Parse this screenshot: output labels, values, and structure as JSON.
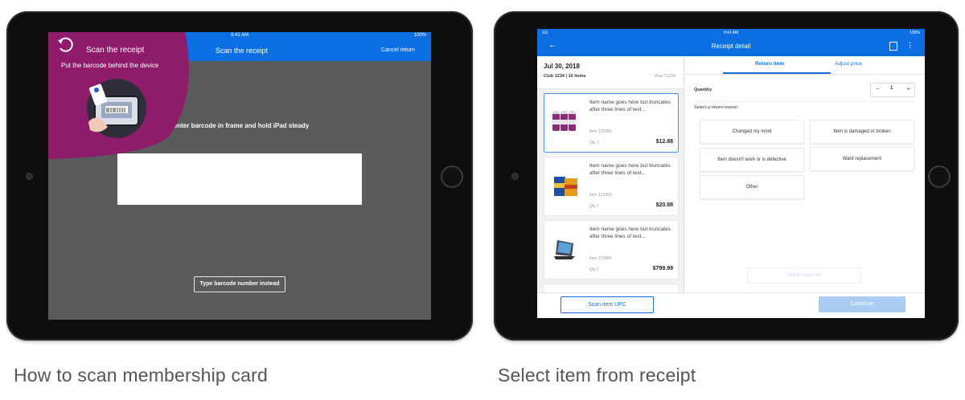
{
  "captions": {
    "left": "How to scan membership card",
    "right": "Select item from receipt"
  },
  "left_screen": {
    "status_time": "9:41 AM",
    "status_battery": "100%",
    "nav_title": "Scan the receipt",
    "nav_cancel": "Cancel return",
    "overlay_title": "Scan the receipt",
    "overlay_subtitle": "Put the barcode behind the device",
    "instruction": "Center barcode in frame and hold iPad steady",
    "type_barcode_button": "Type barcode number instead",
    "colors": {
      "accent_blue": "#0b6fe3",
      "overlay_purple": "#8e1c6a",
      "background_gray": "#5b5b5b"
    }
  },
  "right_screen": {
    "status_left": "GS",
    "status_time": "9:41 AM",
    "status_battery": "100%",
    "nav_title": "Receipt detail",
    "receipt": {
      "date": "Jul 30, 2018",
      "club_items": "Club 1234 | 10 items",
      "visa": "Visa *1234"
    },
    "items": [
      {
        "name": "Item name goes here but truncates after three lines of text...",
        "sku": "Item 123456",
        "qty": "Qty 3",
        "price": "$12.88",
        "thumb": "vitamin-bottles"
      },
      {
        "name": "Item name goes here but truncates after three lines of text...",
        "sku": "Item 123456",
        "qty": "Qty 1",
        "price": "$20.88",
        "thumb": "medicine-box"
      },
      {
        "name": "Item name goes here but truncates after three lines of text...",
        "sku": "Item 123456",
        "qty": "Qty 1",
        "price": "$799.99",
        "thumb": "tablet-keyboard"
      }
    ],
    "tabs": [
      "Return item",
      "Adjust price"
    ],
    "quantity_label": "Quantity",
    "quantity": {
      "minus": "−",
      "value": "1",
      "plus": "+"
    },
    "reason_label": "Select a return reason",
    "reasons": [
      "Changed my mind",
      "Item is damaged or broken",
      "Item doesn't work or is defective",
      "Want replacement",
      "Other"
    ],
    "add_button": "Add to return list",
    "scan_upc_button": "Scan item UPC",
    "continue_button": "Continue",
    "colors": {
      "accent_blue": "#0b6fe3",
      "continue_disabled": "#a9cdf3"
    }
  }
}
